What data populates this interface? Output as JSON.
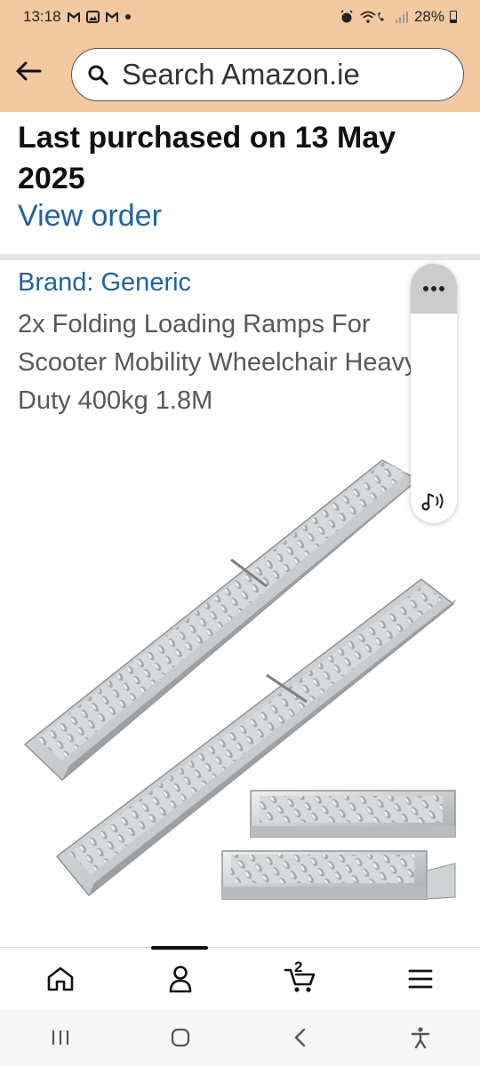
{
  "status_bar": {
    "time": "13:18",
    "left_icons": [
      "gmail-icon",
      "gallery-icon",
      "gmail-icon",
      "dot-icon"
    ],
    "right_icons": [
      "alarm-icon",
      "wifi-call-icon",
      "signal-icon",
      "battery-icon"
    ],
    "battery": "28%"
  },
  "header": {
    "back_icon": "arrow-left-icon",
    "search_placeholder": "Search Amazon.ie"
  },
  "purchase": {
    "text": "Last purchased on 13 May 2025",
    "link": "View order"
  },
  "product": {
    "brand": "Brand: Generic",
    "title": "2x Folding Loading Ramps For Scooter Mobility Wheelchair Heavy Duty 400kg 1.8M"
  },
  "side_panel": {
    "more_icon": "more-dots-icon",
    "audio_icon": "audio-read-icon"
  },
  "bottom_nav": {
    "items": [
      "home-icon",
      "account-icon",
      "cart-icon",
      "menu-icon"
    ],
    "cart_count": "2",
    "active": "account"
  },
  "system_nav": [
    "recent-apps-icon",
    "home-button-icon",
    "back-icon",
    "accessibility-icon"
  ]
}
